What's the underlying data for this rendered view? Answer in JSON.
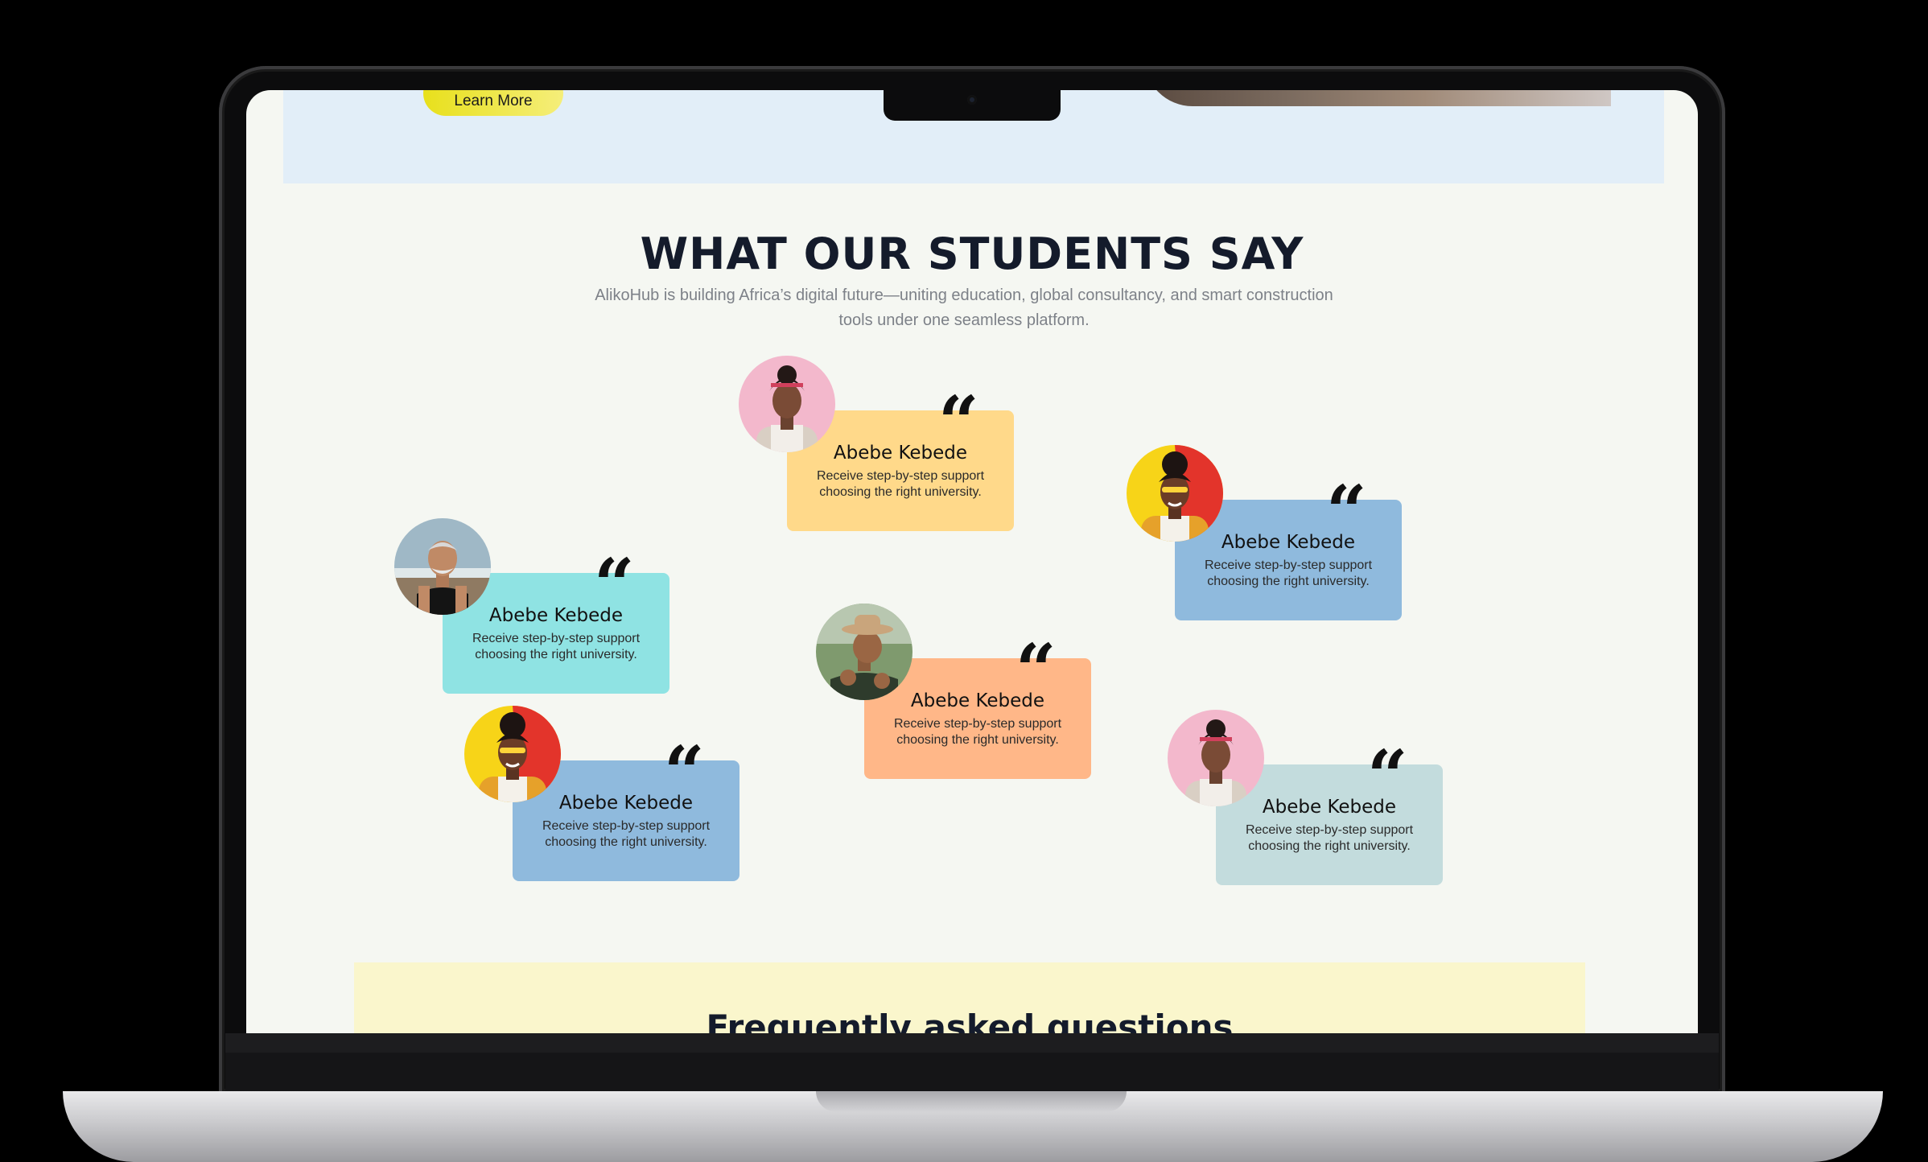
{
  "hero": {
    "button_label": "Learn More"
  },
  "testimonials_section": {
    "title": "WHAT OUR STUDENTS SAY",
    "subtitle": "AlikoHub is building Africa’s digital future—uniting education, global consultancy, and smart construction tools under one seamless platform.",
    "quote_mark": "“",
    "items": [
      {
        "name": "Abebe Kebede",
        "text": "Receive step-by-step support choosing the right university.",
        "card_color": "#ffd98a",
        "avatar": "woman-pink-background"
      },
      {
        "name": "Abebe Kebede",
        "text": "Receive step-by-step support choosing the right university.",
        "card_color": "#8fbadd",
        "avatar": "woman-yellow-red-background"
      },
      {
        "name": "Abebe Kebede",
        "text": "Receive step-by-step support choosing the right university.",
        "card_color": "#8fe3e3",
        "avatar": "older-man-beach"
      },
      {
        "name": "Abebe Kebede",
        "text": "Receive step-by-step support choosing the right university.",
        "card_color": "#ffb788",
        "avatar": "man-with-hat"
      },
      {
        "name": "Abebe Kebede",
        "text": "Receive step-by-step support choosing the right university.",
        "card_color": "#8fbadd",
        "avatar": "woman-yellow-red-background"
      },
      {
        "name": "Abebe Kebede",
        "text": "Receive step-by-step support choosing the right university.",
        "card_color": "#c3dcdd",
        "avatar": "woman-pink-background"
      }
    ]
  },
  "faq": {
    "title": "Frequently asked questions"
  }
}
